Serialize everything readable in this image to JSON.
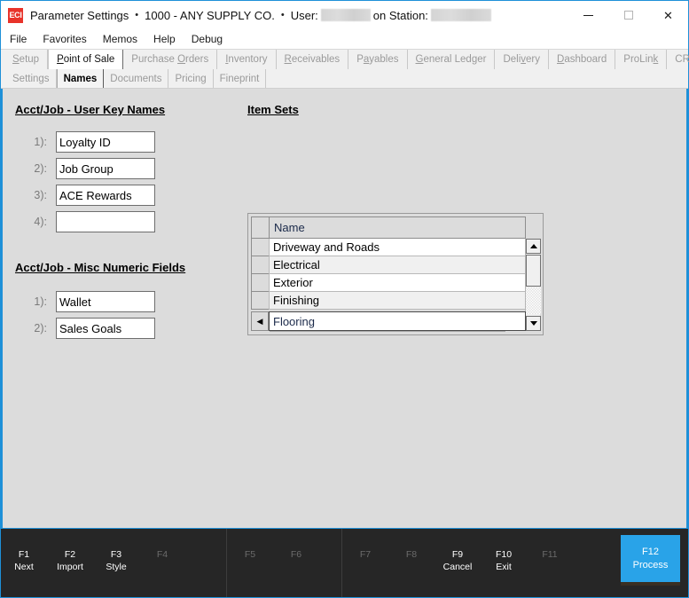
{
  "window": {
    "app_icon_text": "ECI",
    "title": "Parameter Settings",
    "company": "1000 - ANY SUPPLY CO.",
    "user_label": "User:",
    "station_label": "on Station:",
    "separator": "•",
    "minimize_icon": "minimize-icon",
    "maximize_icon": "maximize-icon",
    "close_icon": "close-icon",
    "close_glyph": "✕"
  },
  "menubar": {
    "items": [
      {
        "label": "File"
      },
      {
        "label": "Favorites"
      },
      {
        "label": "Memos"
      },
      {
        "label": "Help"
      },
      {
        "label": "Debug"
      }
    ]
  },
  "tabs": {
    "items": [
      {
        "pre": "",
        "accel": "S",
        "post": "etup",
        "active": false
      },
      {
        "pre": "",
        "accel": "P",
        "post": "oint of Sale",
        "active": true
      },
      {
        "pre": "Purchase ",
        "accel": "O",
        "post": "rders",
        "active": false
      },
      {
        "pre": "",
        "accel": "I",
        "post": "nventory",
        "active": false
      },
      {
        "pre": "",
        "accel": "R",
        "post": "eceivables",
        "active": false
      },
      {
        "pre": "P",
        "accel": "a",
        "post": "yables",
        "active": false
      },
      {
        "pre": "",
        "accel": "G",
        "post": "eneral Ledger",
        "active": false
      },
      {
        "pre": "Deli",
        "accel": "v",
        "post": "ery",
        "active": false
      },
      {
        "pre": "",
        "accel": "D",
        "post": "ashboard",
        "active": false
      },
      {
        "pre": "ProLin",
        "accel": "k",
        "post": "",
        "active": false
      },
      {
        "pre": "CRM",
        "accel": "",
        "post": "",
        "active": false
      }
    ]
  },
  "subtabs": {
    "items": [
      {
        "label": "Settings",
        "active": false
      },
      {
        "label": "Names",
        "active": true
      },
      {
        "label": "Documents",
        "active": false
      },
      {
        "label": "Pricing",
        "active": false
      },
      {
        "label": "Fineprint",
        "active": false
      }
    ]
  },
  "userkeys": {
    "title": "Acct/Job - User Key Names",
    "fields": [
      {
        "label": "1):",
        "value": "Loyalty ID",
        "placeholder": ""
      },
      {
        "label": "2):",
        "value": "Job Group",
        "placeholder": ""
      },
      {
        "label": "3):",
        "value": "ACE Rewards",
        "placeholder": ""
      },
      {
        "label": "4):",
        "value": "",
        "placeholder": ""
      }
    ]
  },
  "miscnumeric": {
    "title": "Acct/Job - Misc Numeric Fields",
    "fields": [
      {
        "label": "1):",
        "value": "Wallet",
        "placeholder": ""
      },
      {
        "label": "2):",
        "value": "Sales Goals",
        "placeholder": ""
      }
    ]
  },
  "itemsets": {
    "title": "Item Sets",
    "column_header": "Name",
    "rows": [
      {
        "name": "Driveway and Roads"
      },
      {
        "name": "Electrical"
      },
      {
        "name": "Exterior"
      },
      {
        "name": "Finishing"
      }
    ],
    "current_row": {
      "name": "Flooring",
      "indicator": "◀"
    },
    "scroll_up_icon": "scroll-up-arrow-icon",
    "scroll_down_icon": "scroll-down-arrow-icon"
  },
  "fkeys": {
    "group1": [
      {
        "key": "F1",
        "label": "Next",
        "active": true
      },
      {
        "key": "F2",
        "label": "Import",
        "active": true
      },
      {
        "key": "F3",
        "label": "Style",
        "active": true
      },
      {
        "key": "F4",
        "label": "",
        "active": false
      }
    ],
    "group2": [
      {
        "key": "F5",
        "label": "",
        "active": false
      },
      {
        "key": "F6",
        "label": "",
        "active": false
      }
    ],
    "group3": [
      {
        "key": "F7",
        "label": "",
        "active": false
      },
      {
        "key": "F8",
        "label": "",
        "active": false
      },
      {
        "key": "F9",
        "label": "Cancel",
        "active": true
      },
      {
        "key": "F10",
        "label": "Exit",
        "active": true
      },
      {
        "key": "F11",
        "label": "",
        "active": false
      }
    ],
    "process": {
      "key": "F12",
      "label": "Process"
    }
  },
  "colors": {
    "accent_blue": "#1e90d8",
    "process_blue": "#29a3e8",
    "app_icon_red": "#e8332a",
    "panel_gray": "#dcdcdc",
    "fkbar_dark": "#262626"
  }
}
